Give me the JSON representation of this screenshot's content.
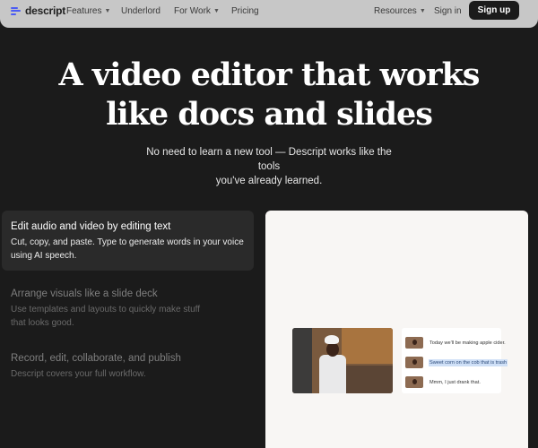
{
  "nav": {
    "brand": "descript",
    "items": [
      {
        "label": "Features",
        "has_dropdown": true
      },
      {
        "label": "Underlord",
        "has_dropdown": false
      },
      {
        "label": "For Work",
        "has_dropdown": true
      },
      {
        "label": "Pricing",
        "has_dropdown": false
      }
    ],
    "resources": {
      "label": "Resources",
      "has_dropdown": true
    },
    "sign_in": "Sign in",
    "sign_up": "Sign up"
  },
  "hero": {
    "title_line1": "A video editor that works",
    "title_line2": "like docs and slides",
    "subtitle_line1": "No need to learn a new tool — Descript works like the tools",
    "subtitle_line2": "you've already learned."
  },
  "features": [
    {
      "title": "Edit audio and video by editing text",
      "desc_line1": "Cut, copy, and paste. Type to generate words in your voice",
      "desc_line2": "using AI speech.",
      "active": true
    },
    {
      "title": "Arrange visuals like a slide deck",
      "desc_line1": "Use templates and layouts to quickly make stuff",
      "desc_line2": "that looks good.",
      "active": false
    },
    {
      "title": "Record, edit, collaborate, and publish",
      "desc_line1": "Descript covers your full workflow.",
      "desc_line2": "",
      "active": false
    }
  ],
  "demo": {
    "transcript": [
      {
        "text": "Today we'll be making apple cider.",
        "highlighted": false
      },
      {
        "text": "Sweet corn on the cob that is trash",
        "highlighted": true
      },
      {
        "text": "Mmm, I just drank that.",
        "highlighted": false
      }
    ]
  },
  "colors": {
    "background": "#1b1b1b",
    "nav_background": "#c7c7c7",
    "brand_accent": "#4c5cf4",
    "highlight": "#cfe0f7"
  }
}
